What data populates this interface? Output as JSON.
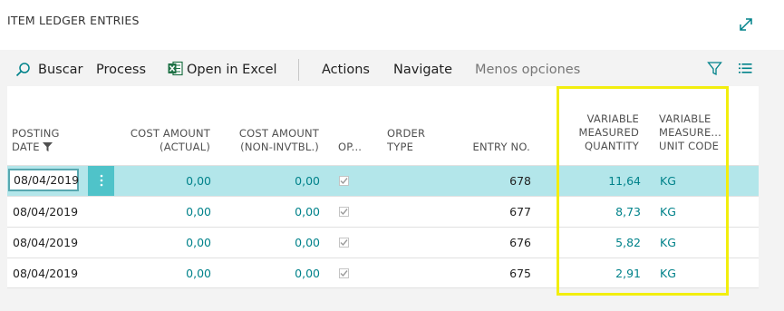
{
  "page": {
    "title": "ITEM LEDGER ENTRIES"
  },
  "toolbar": {
    "search_label": "Buscar",
    "process_label": "Process",
    "excel_label": "Open in Excel",
    "actions_label": "Actions",
    "navigate_label": "Navigate",
    "less_options_label": "Menos opciones"
  },
  "icons": {
    "search": "search-icon",
    "excel": "excel-icon",
    "filter": "filter-icon",
    "list": "list-view-icon",
    "expand": "expand-icon",
    "menu": "vertical-ellipsis-icon",
    "check": "checkbox-checked-icon"
  },
  "colors": {
    "accent": "#00828a",
    "selected_row": "#b3e6ea",
    "menu_button": "#4fc3c9",
    "highlight_box": "#f2ee0e"
  },
  "columns": {
    "posting_date": [
      "POSTING",
      "DATE"
    ],
    "cost_actual": [
      "COST AMOUNT",
      "(ACTUAL)"
    ],
    "cost_non_invtbl": [
      "COST AMOUNT",
      "(NON-INVTBL.)"
    ],
    "open": "OP...",
    "order_type": [
      "ORDER",
      "TYPE"
    ],
    "entry_no": "ENTRY NO.",
    "var_qty": [
      "VARIABLE",
      "MEASURED",
      "QUANTITY"
    ],
    "var_unit": [
      "VARIABLE",
      "MEASURE...",
      "UNIT CODE"
    ]
  },
  "rows": [
    {
      "posting_date": "08/04/2019",
      "cost_actual": "0,00",
      "cost_non_invtbl": "0,00",
      "entry_no": "678",
      "var_qty": "11,64",
      "var_unit": "KG"
    },
    {
      "posting_date": "08/04/2019",
      "cost_actual": "0,00",
      "cost_non_invtbl": "0,00",
      "entry_no": "677",
      "var_qty": "8,73",
      "var_unit": "KG"
    },
    {
      "posting_date": "08/04/2019",
      "cost_actual": "0,00",
      "cost_non_invtbl": "0,00",
      "entry_no": "676",
      "var_qty": "5,82",
      "var_unit": "KG"
    },
    {
      "posting_date": "08/04/2019",
      "cost_actual": "0,00",
      "cost_non_invtbl": "0,00",
      "entry_no": "675",
      "var_qty": "2,91",
      "var_unit": "KG"
    }
  ]
}
